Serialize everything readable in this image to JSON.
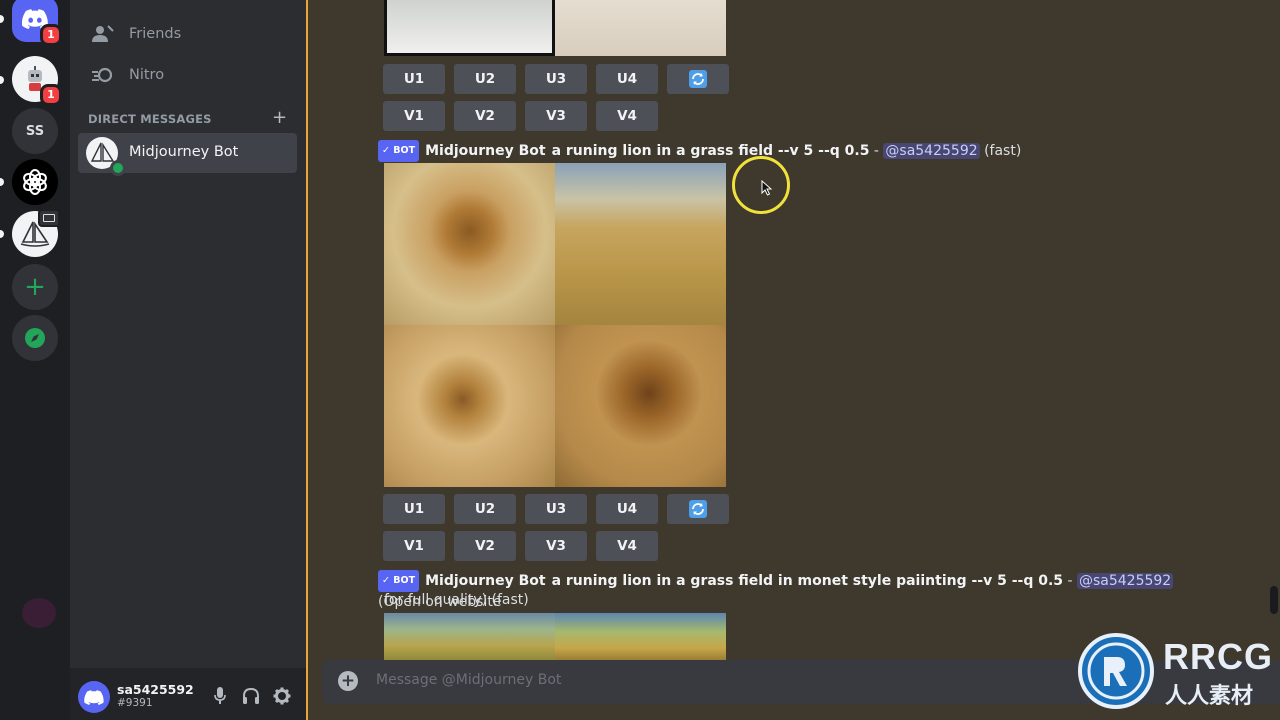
{
  "servers": [
    {
      "name": "discord-home",
      "badge": "1",
      "bg": "#5865f2"
    },
    {
      "name": "robot-server",
      "badge": "1",
      "bg": "#f2f3f5"
    },
    {
      "name": "ss-server",
      "label": "SS",
      "bg": "#313338"
    },
    {
      "name": "openai-server",
      "bg": "#000000"
    },
    {
      "name": "midjourney-server",
      "bg": "#f2f3f5"
    },
    {
      "name": "add-server",
      "bg": "#313338"
    },
    {
      "name": "explore",
      "bg": "#313338"
    }
  ],
  "nav": {
    "friends": "Friends",
    "nitro": "Nitro",
    "dm_header": "DIRECT MESSAGES",
    "dm_add": "+",
    "dm_item": "Midjourney Bot"
  },
  "user": {
    "name": "sa5425592",
    "tag": "#9391"
  },
  "messages": [
    {
      "buttons_u": [
        "U1",
        "U2",
        "U3",
        "U4"
      ],
      "buttons_v": [
        "V1",
        "V2",
        "V3",
        "V4"
      ]
    },
    {
      "badge": "BOT",
      "author": "Midjourney Bot",
      "prompt": "a runing lion in a grass field --v 5 --q 0.5",
      "sep": " - ",
      "mention": "@sa5425592",
      "suffix": " (fast)",
      "buttons_u": [
        "U1",
        "U2",
        "U3",
        "U4"
      ],
      "buttons_v": [
        "V1",
        "V2",
        "V3",
        "V4"
      ]
    },
    {
      "badge": "BOT",
      "author": "Midjourney Bot",
      "prompt": "a runing lion in a grass field in monet style paiinting --v 5 --q 0.5",
      "sep": " - ",
      "mention": "@sa5425592",
      "suffix": " (Open on website",
      "line2": "for full quality) (fast)"
    }
  ],
  "composer": {
    "placeholder": "Message @Midjourney Bot"
  },
  "watermark": {
    "brand": "RRCG",
    "sub": "人人素材"
  },
  "colors": {
    "accent": "#5865f2",
    "online": "#23a55a",
    "badge_red": "#f23f42",
    "highlight_border": "#e8a53a",
    "cursor_ring": "#f1e13b"
  }
}
